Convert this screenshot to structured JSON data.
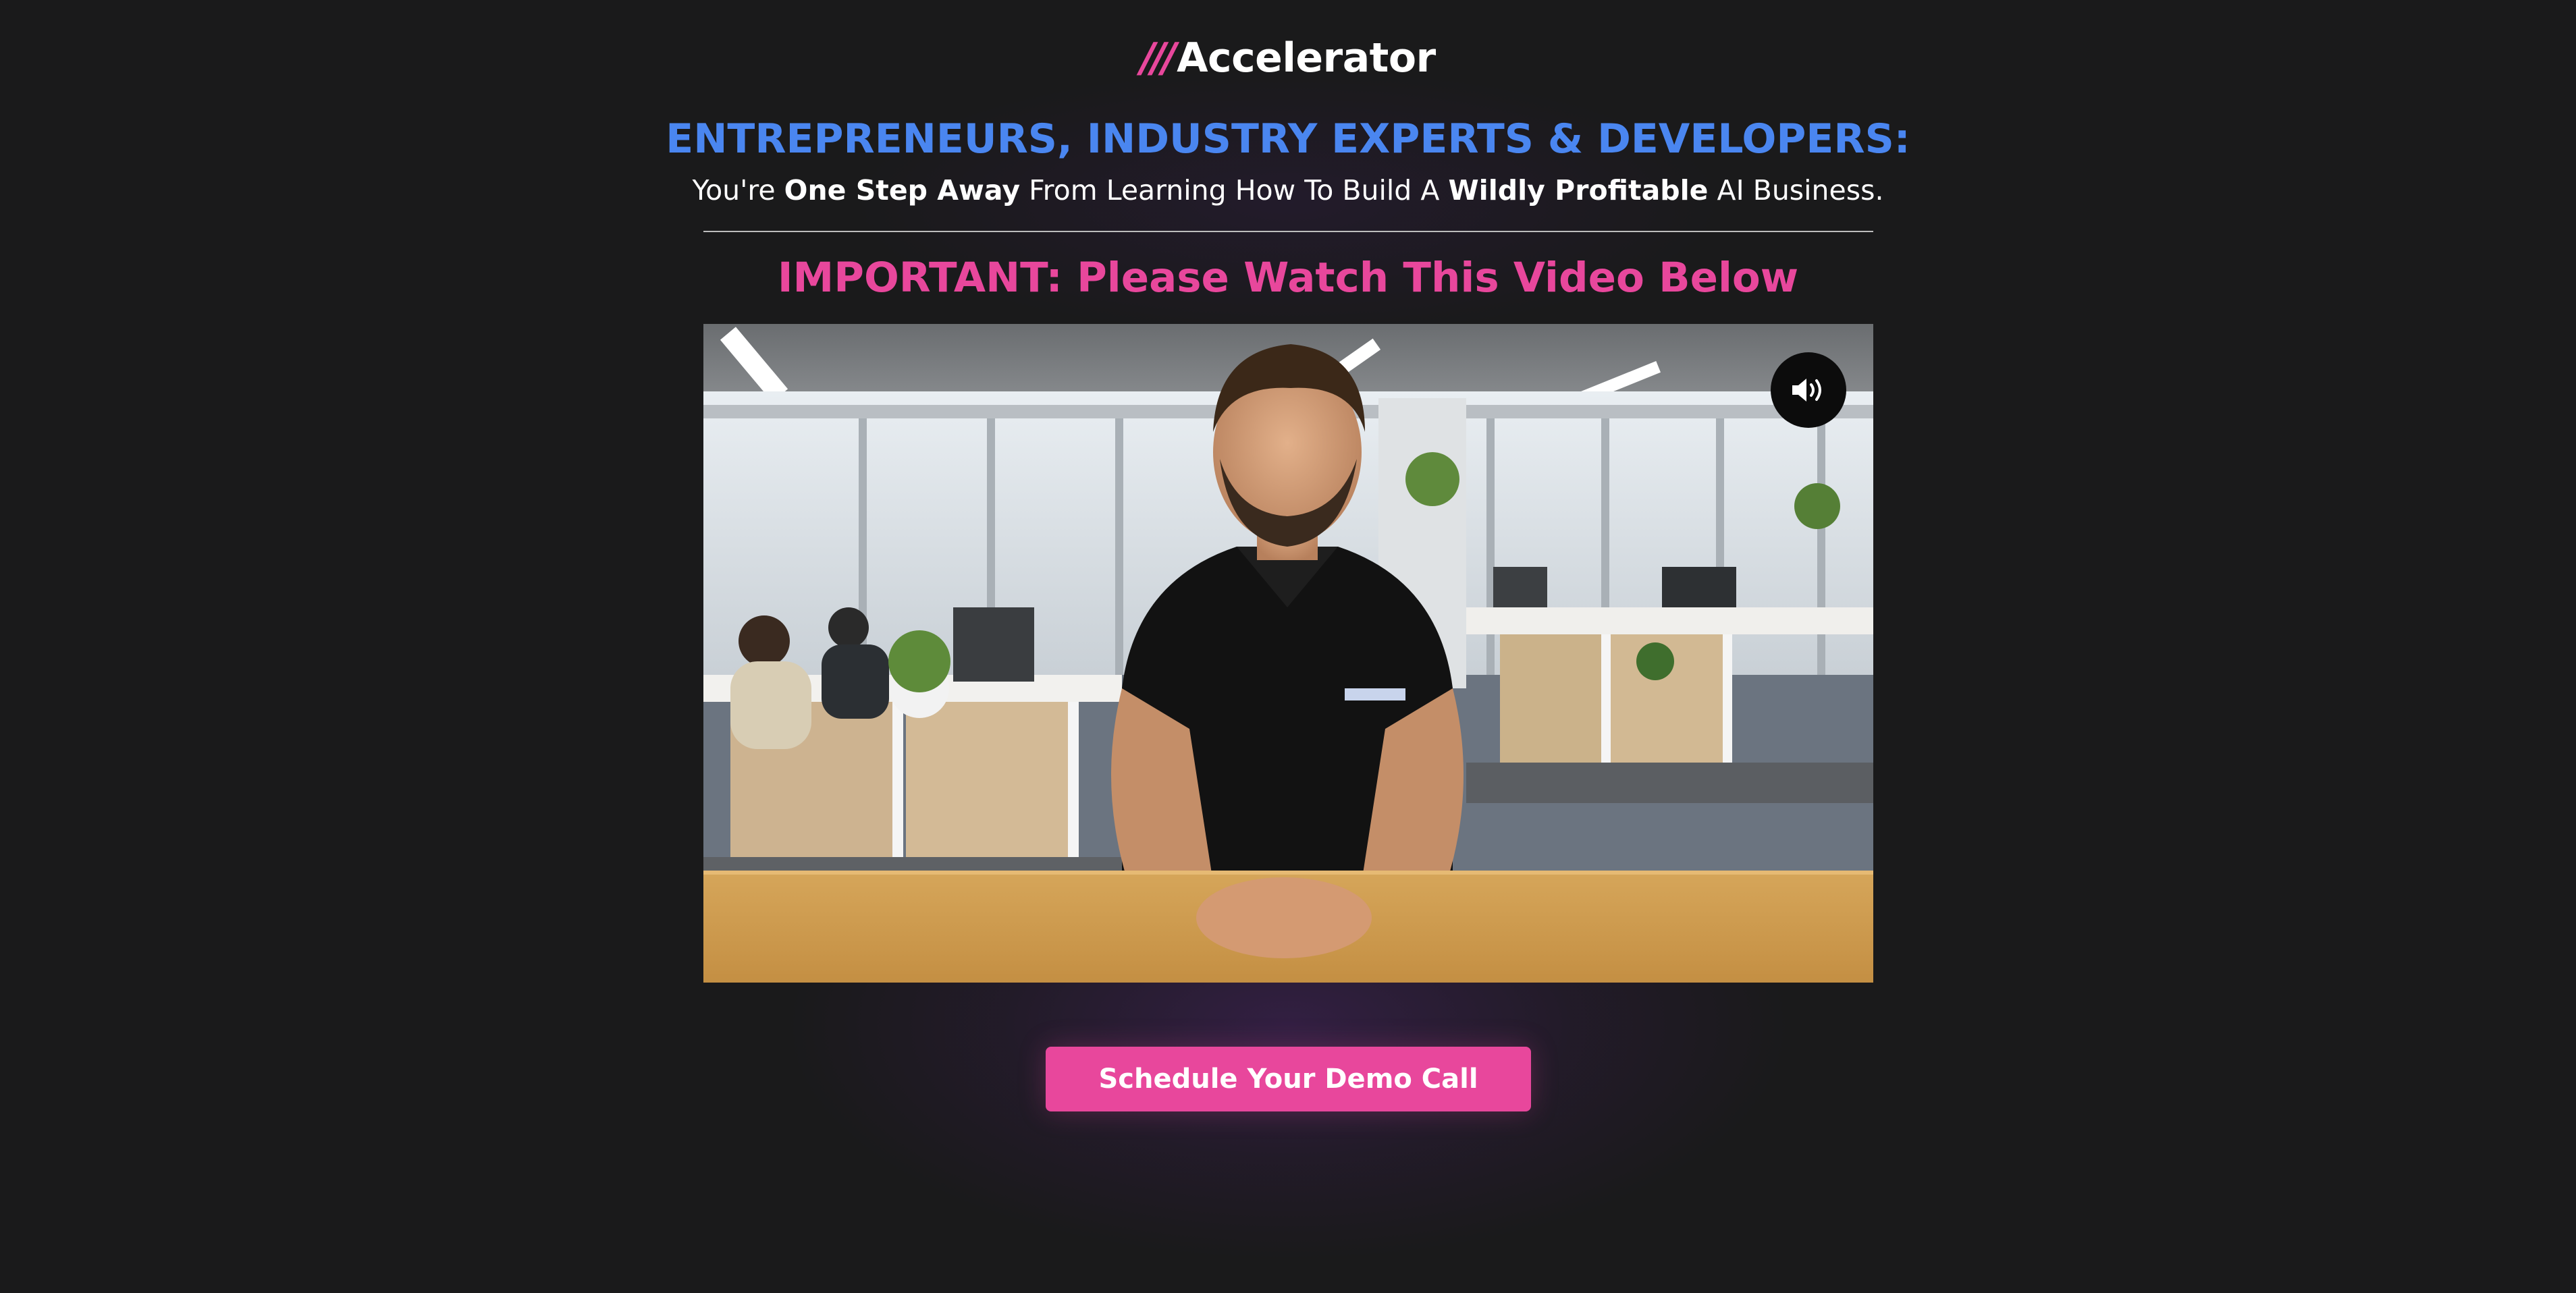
{
  "logo": {
    "slashes": "///",
    "name": "Accelerator"
  },
  "hero": {
    "headline": "ENTREPRENEURS, INDUSTRY EXPERTS & DEVELOPERS:",
    "subhead_parts": {
      "p1": "You're ",
      "b1": "One Step Away",
      "p2": " From Learning How To Build A ",
      "b2": "Wildly Profitable",
      "p3": " AI Business."
    },
    "important": "IMPORTANT: Please Watch This Video Below"
  },
  "video": {
    "sound_icon": "speaker-volume-icon"
  },
  "cta": {
    "label": "Schedule Your Demo Call"
  },
  "colors": {
    "background": "#1a1a1b",
    "accent_pink": "#e8479c",
    "headline_blue": "#4a86f0"
  }
}
